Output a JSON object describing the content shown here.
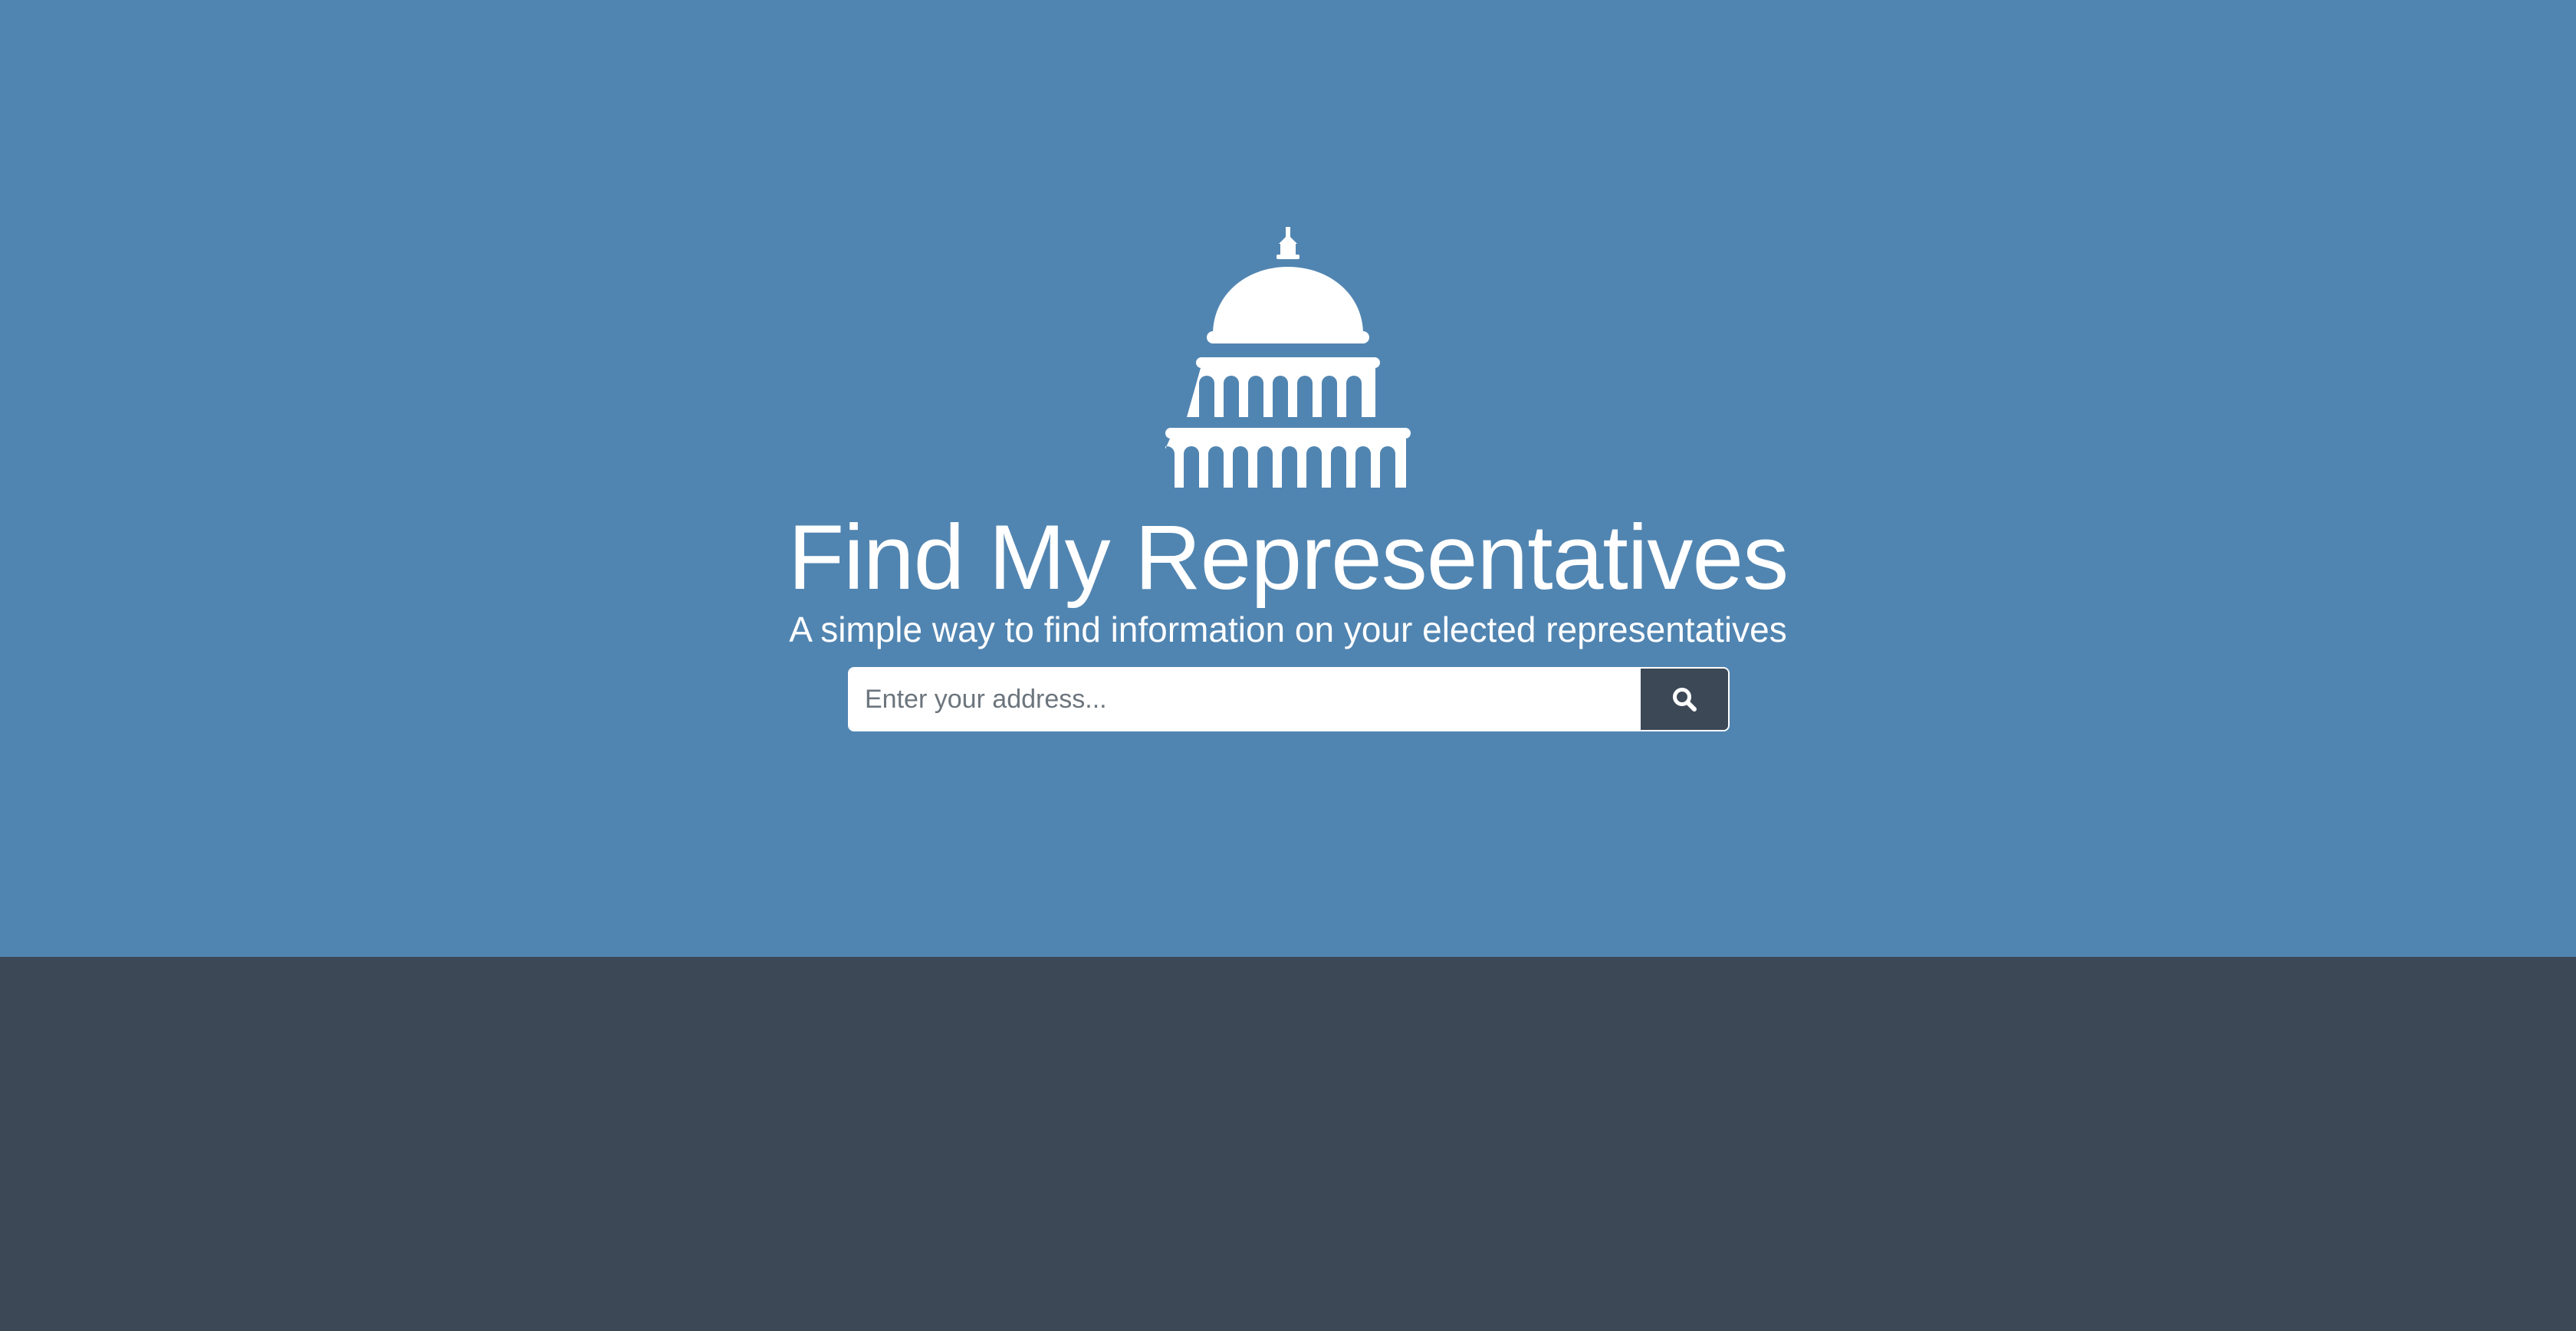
{
  "colors": {
    "hero_background": "#5185b1",
    "footer_background": "#3c4856",
    "search_button": "#3c4856",
    "text": "#ffffff"
  },
  "logo": {
    "icon": "capitol-building-icon"
  },
  "hero": {
    "title": "Find My Representatives",
    "subtitle": "A simple way to find information on your elected representatives"
  },
  "search": {
    "placeholder": "Enter your address...",
    "value": "",
    "button_icon": "search-icon"
  }
}
